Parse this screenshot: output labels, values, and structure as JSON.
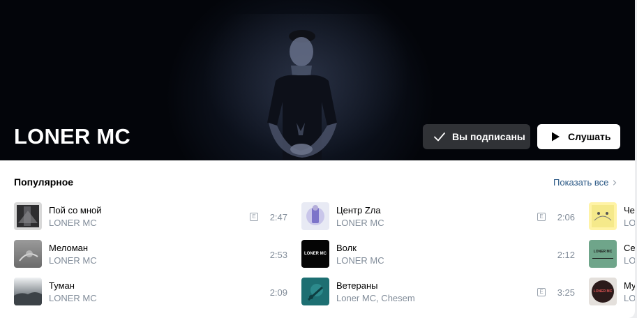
{
  "artist": {
    "name": "LONER MC"
  },
  "buttons": {
    "subscribed_label": "Вы подписаны",
    "listen_label": "Слушать"
  },
  "popular": {
    "title": "Популярное",
    "show_all_label": "Показать все",
    "columns": [
      [
        {
          "title": "Пой со мной",
          "artist": "LONER MC",
          "explicit": true,
          "explicit_mark": "E",
          "duration": "2:47"
        },
        {
          "title": "Меломан",
          "artist": "LONER MC",
          "explicit": false,
          "duration": "2:53"
        },
        {
          "title": "Туман",
          "artist": "LONER MC",
          "explicit": false,
          "duration": "2:09"
        }
      ],
      [
        {
          "title": "Центр Zла",
          "artist": "LONER MC",
          "explicit": true,
          "explicit_mark": "E",
          "duration": "2:06"
        },
        {
          "title": "Волк",
          "artist": "LONER MC",
          "explicit": false,
          "duration": "2:12",
          "cover_text": "LONER MC"
        },
        {
          "title": "Ветераны",
          "artist": "Loner MC, Chesem",
          "explicit": true,
          "explicit_mark": "E",
          "duration": "3:25"
        }
      ],
      [
        {
          "title": "Че",
          "artist": "LO"
        },
        {
          "title": "Се",
          "artist": "LO",
          "cover_text": "LONER MC"
        },
        {
          "title": "Му",
          "artist": "LO",
          "cover_text": "LONER MC"
        }
      ]
    ]
  },
  "colors": {
    "link": "#2a5885",
    "secondary_text": "#818c99"
  }
}
